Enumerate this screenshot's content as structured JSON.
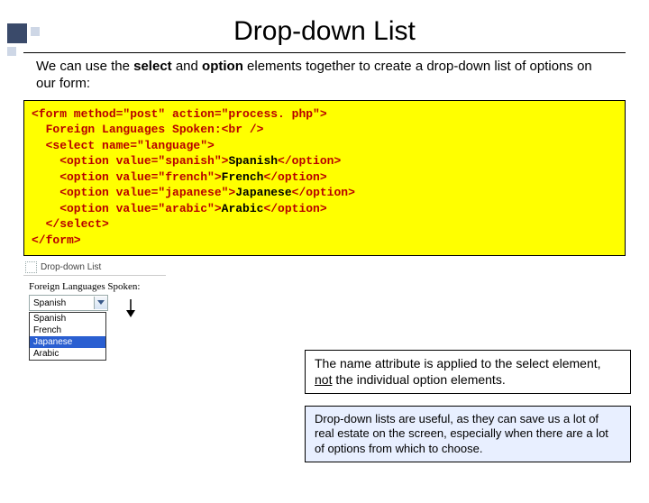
{
  "title": "Drop-down List",
  "intro_pre": "We can use the ",
  "intro_b1": "select",
  "intro_mid": " and ",
  "intro_b2": "option",
  "intro_post": " elements together to create a drop-down list of options on our form:",
  "code": {
    "l1a": "<form method=\"post\" action=\"process. php\">",
    "l2a": "  Foreign Languages Spoken:<br />",
    "l3a": "  <select name=\"language\">",
    "l4a": "    <option value=\"spanish\">",
    "l4b": "Spanish",
    "l4c": "</option>",
    "l5a": "    <option value=\"french\">",
    "l5b": "French",
    "l5c": "</option>",
    "l6a": "    <option value=\"japanese\">",
    "l6b": "Japanese",
    "l6c": "</option>",
    "l7a": "    <option value=\"arabic\">",
    "l7b": "Arabic",
    "l7c": "</option>",
    "l8a": "  </select>",
    "l9a": "</form>"
  },
  "mock": {
    "tab": "Drop-down List",
    "label": "Foreign Languages Spoken:",
    "selected": "Spanish",
    "options": [
      "Spanish",
      "French",
      "Japanese",
      "Arabic"
    ],
    "highlight_index": 2
  },
  "callout1_a": "The name attribute is applied to the select element, ",
  "callout1_u": "not",
  "callout1_b": " the individual option elements.",
  "callout2": "Drop-down lists are useful, as they can save us a lot of real estate on the screen, especially when there are a lot of options from which to choose."
}
